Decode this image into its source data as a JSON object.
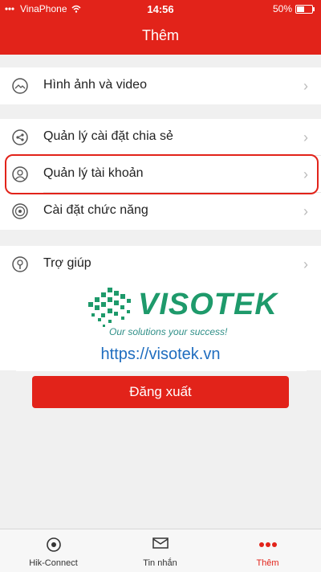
{
  "status_bar": {
    "carrier": "VinaPhone",
    "time": "14:56",
    "battery": "50%",
    "battery_level": 0.5
  },
  "header": {
    "title": "Thêm"
  },
  "menu": {
    "group1": [
      {
        "label": "Hình ảnh và video",
        "icon": "image-video-icon"
      }
    ],
    "group2": [
      {
        "label": "Quản lý cài đặt chia sẻ",
        "icon": "share-settings-icon"
      },
      {
        "label": "Quản lý tài khoản",
        "icon": "account-icon"
      },
      {
        "label": "Cài đặt chức năng",
        "icon": "function-settings-icon"
      }
    ],
    "group3": [
      {
        "label": "Trợ giúp",
        "icon": "help-icon"
      }
    ]
  },
  "watermark": {
    "brand": "VISOTEK",
    "slogan": "Our solutions your success!",
    "url": "https://visotek.vn"
  },
  "logout_label": "Đăng xuất",
  "tabs": [
    {
      "label": "Hik-Connect",
      "icon": "hik-connect-icon"
    },
    {
      "label": "Tin nhắn",
      "icon": "message-icon"
    },
    {
      "label": "Thêm",
      "icon": "more-icon",
      "active": true
    }
  ],
  "colors": {
    "accent": "#e2231a",
    "background": "#f0f0f0",
    "brand_green": "#1e9a6b",
    "url_blue": "#1f6dbf"
  }
}
